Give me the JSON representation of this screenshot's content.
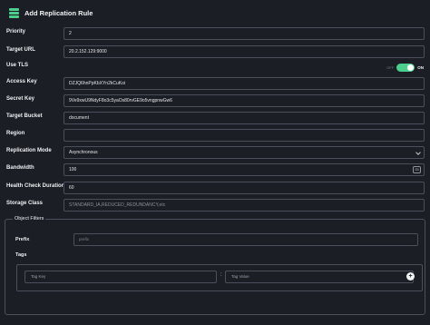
{
  "header": {
    "title": "Add Replication Rule"
  },
  "form": {
    "priority": {
      "label": "Priority",
      "value": "2"
    },
    "target_url": {
      "label": "Target URL",
      "value": "20.2.152.129:9000"
    },
    "use_tls": {
      "label": "Use TLS",
      "off_label": "OFF",
      "on_label": "ON",
      "enabled": true
    },
    "access_key": {
      "label": "Access Key",
      "value": "DZJQ6hnPpKbXYn2kCuKoi"
    },
    "secret_key": {
      "label": "Secret Key",
      "value": "9Ve9xwU9NdyF8o3c5yaOs80rvGE9o5vngpnwGw6"
    },
    "target_bucket": {
      "label": "Target Bucket",
      "value": "document"
    },
    "region": {
      "label": "Region",
      "value": ""
    },
    "replication_mode": {
      "label": "Replication Mode",
      "value": "Asynchronous"
    },
    "bandwidth": {
      "label": "Bandwidth",
      "value": "100",
      "unit": "Gi"
    },
    "health_check": {
      "label": "Health Check Duration",
      "value": "60"
    },
    "storage_class": {
      "label": "Storage Class",
      "value": "STANDARD_IA,REDUCED_REDUNDANCY,etc"
    }
  },
  "object_filters": {
    "legend": "Object Filters",
    "prefix_label": "Prefix",
    "prefix_placeholder": "prefix",
    "tags_label": "Tags",
    "tag_key_placeholder": "Tag Key",
    "tag_separator": ":",
    "tag_value_placeholder": "Tag Value",
    "add_symbol": "+"
  },
  "colors": {
    "accent": "#4ccf8c",
    "background": "#1c1e25",
    "border": "#4a4f5b"
  }
}
